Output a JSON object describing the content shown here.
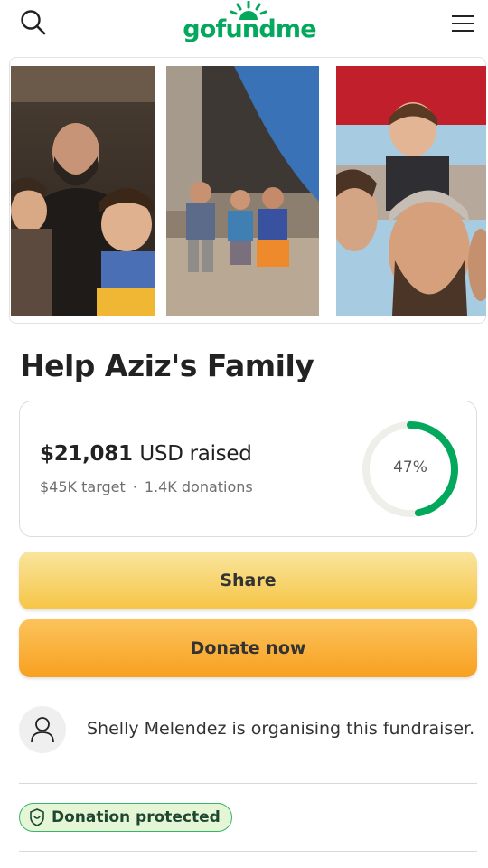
{
  "header": {
    "logo_text": "gofundme",
    "search_icon": "search-icon",
    "menu_icon": "hamburger-menu-icon",
    "brand_color": "#02a95c"
  },
  "gallery": {
    "photos": [
      "photo-1",
      "photo-2",
      "photo-3"
    ]
  },
  "campaign": {
    "title": "Help Aziz's Family"
  },
  "progress": {
    "amount": "$21,081",
    "amount_label": "USD raised",
    "target": "$45K target",
    "separator": "·",
    "donations": "1.4K donations",
    "percent_text": "47%",
    "percent_value": 0.47,
    "ring_color": "#02a95c",
    "track_color": "#efefe9"
  },
  "actions": {
    "share_label": "Share",
    "donate_label": "Donate now"
  },
  "organiser": {
    "text": "Shelly Melendez is organising this fundraiser.",
    "avatar_icon": "user-icon"
  },
  "badge": {
    "label": "Donation protected",
    "icon": "shield-icon"
  }
}
